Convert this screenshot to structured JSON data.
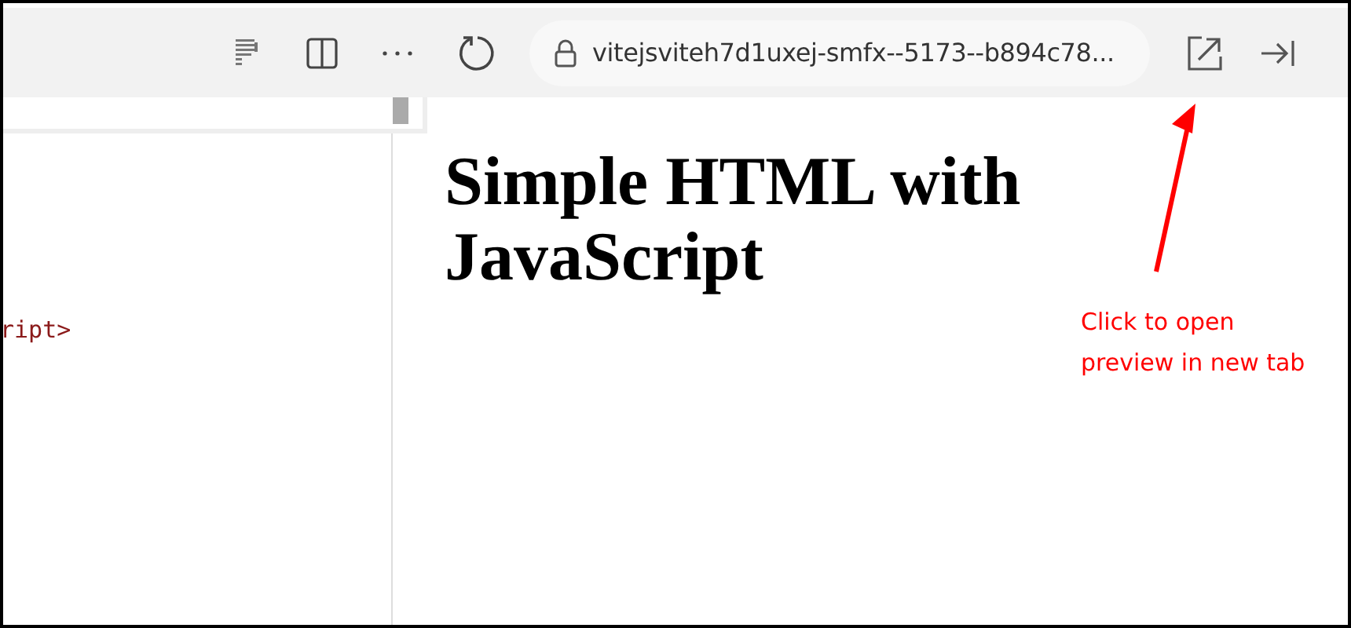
{
  "toolbar": {
    "address": "vitejsviteh7d1uxej-smfx--5173--b894c78..."
  },
  "editor": {
    "lines": [
      "ript>"
    ]
  },
  "preview": {
    "heading": "Simple HTML with JavaScript"
  },
  "annotation": {
    "text": "Click to open preview in new tab"
  }
}
